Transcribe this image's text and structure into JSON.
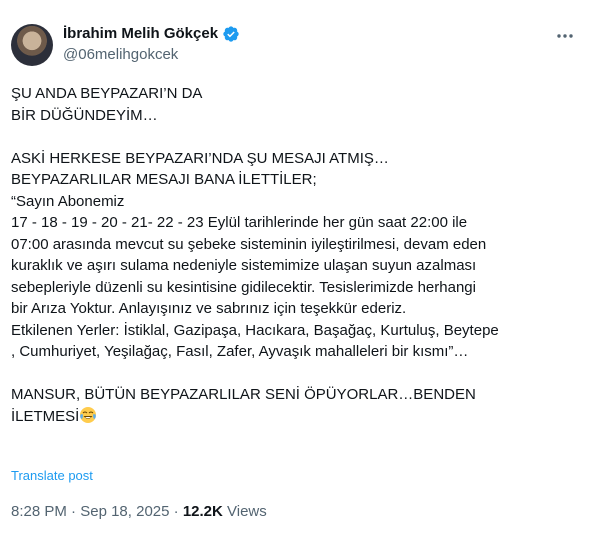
{
  "author": {
    "name": "İbrahim Melih Gökçek",
    "handle": "@06melihgokcek",
    "verified": true
  },
  "tweet": {
    "text": "ŞU ANDA BEYPAZARI’N DA\nBİR DÜĞÜNDEYİM…\n\nASKİ HERKESE BEYPAZARI’NDA ŞU MESAJI ATMIŞ…\nBEYPAZARLILAR MESAJI BANA İLETTİLER;\n“Sayın Abonemiz\n17 - 18 - 19 - 20 - 21- 22 - 23 Eylül tarihlerinde her gün saat 22:00 ile\n07:00 arasında mevcut su şebeke sisteminin iyileştirilmesi, devam eden\nkuraklık ve aşırı sulama nedeniyle sistemimize ulaşan suyun azalması\nsebepleriyle düzenli su kesintisine gidilecektir. Tesislerimizde herhangi\nbir Arıza Yoktur. Anlayışınız ve sabrınız için teşekkür ederiz.\nEtkilenen Yerler: İstiklal, Gazipaşa, Hacıkara, Başağaç, Kurtuluş, Beytepe\n, Cumhuriyet, Yeşilağaç, Fasıl, Zafer, Ayvaşık mahalleleri bir kısmı”…\n\nMANSUR, BÜTÜN BEYPAZARLILAR SENİ ÖPÜYORLAR…BENDEN\nİLETMESİ",
    "emoji": "face-with-tears-of-joy",
    "translate_label": "Translate post",
    "time": "8:28 PM",
    "separator": "·",
    "date": "Sep 18, 2025",
    "views_count": "12.2K",
    "views_label": "Views"
  },
  "icons": {
    "verified": "verified-badge-icon",
    "more": "more-options-icon"
  },
  "colors": {
    "text": "#0f1419",
    "secondary": "#536471",
    "link": "#1d9bf0",
    "verified": "#1d9bf0"
  }
}
